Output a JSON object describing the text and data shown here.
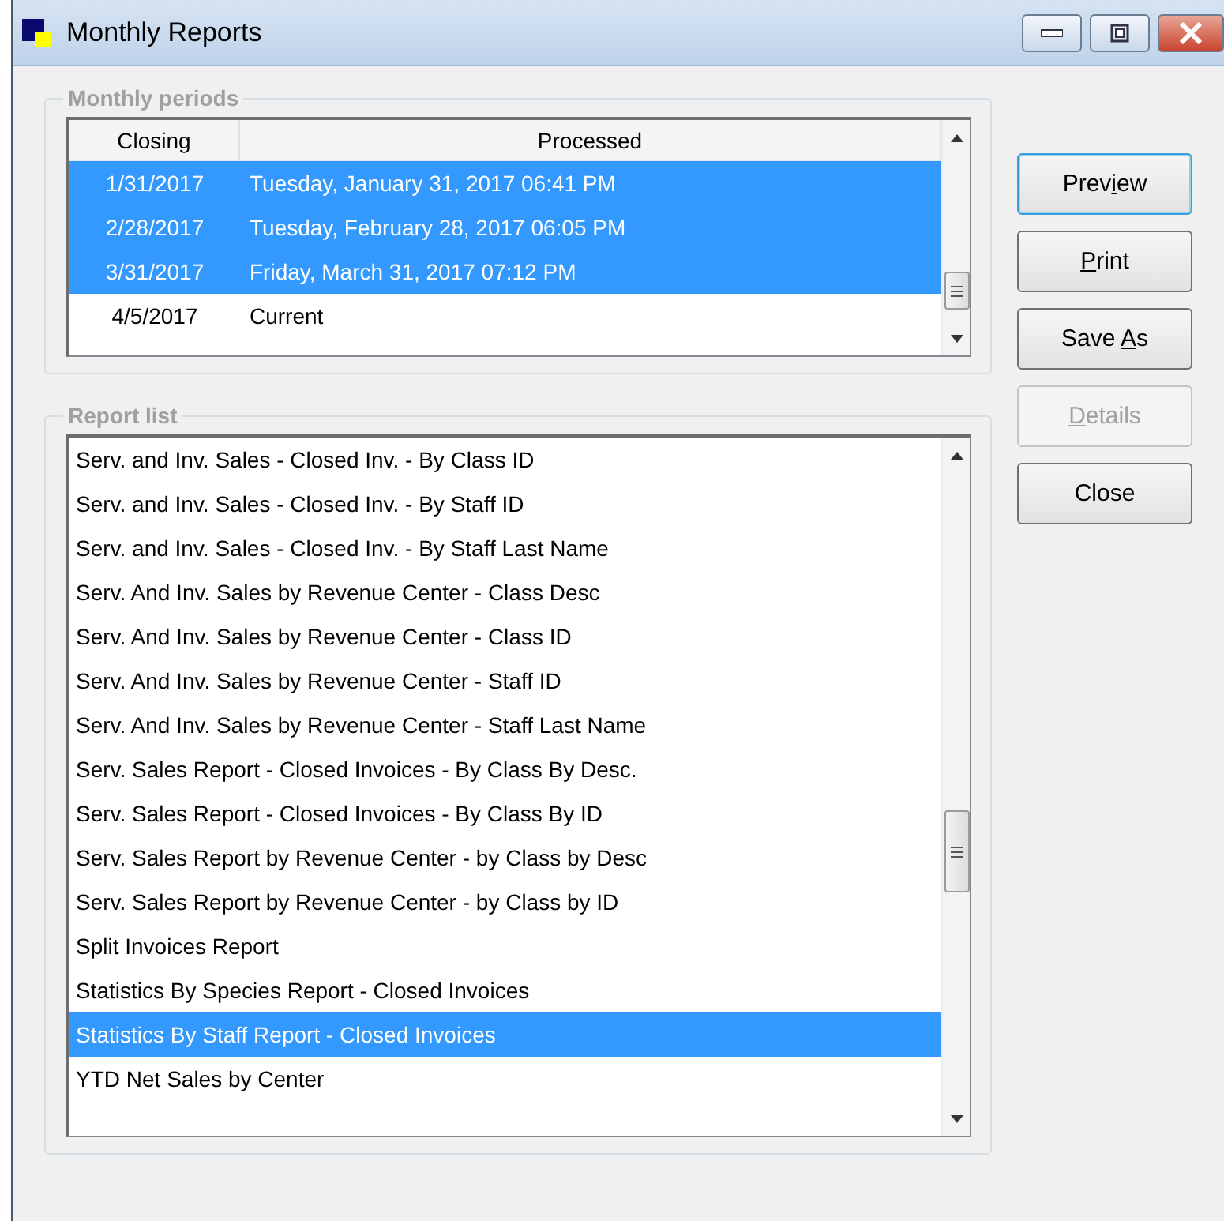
{
  "window": {
    "title": "Monthly Reports"
  },
  "monthly_periods": {
    "title": "Monthly periods",
    "columns": [
      "Closing",
      "Processed"
    ],
    "rows": [
      {
        "closing": "1/31/2017",
        "processed": "Tuesday, January 31, 2017 06:41 PM",
        "selected": true
      },
      {
        "closing": "2/28/2017",
        "processed": "Tuesday, February 28, 2017 06:05 PM",
        "selected": true
      },
      {
        "closing": "3/31/2017",
        "processed": "Friday, March 31, 2017 07:12 PM",
        "selected": true
      },
      {
        "closing": "4/5/2017",
        "processed": "Current",
        "selected": false
      }
    ]
  },
  "report_list": {
    "title": "Report list",
    "items": [
      {
        "label": "Serv. and Inv. Sales - Closed Inv. - By Class ID",
        "selected": false
      },
      {
        "label": "Serv. and Inv. Sales - Closed Inv. - By Staff ID",
        "selected": false
      },
      {
        "label": "Serv. and Inv. Sales - Closed Inv. - By Staff Last Name",
        "selected": false
      },
      {
        "label": "Serv. And Inv. Sales by Revenue Center - Class Desc",
        "selected": false
      },
      {
        "label": "Serv. And Inv. Sales by Revenue Center - Class ID",
        "selected": false
      },
      {
        "label": "Serv. And Inv. Sales by Revenue Center - Staff ID",
        "selected": false
      },
      {
        "label": "Serv. And Inv. Sales by Revenue Center - Staff Last Name",
        "selected": false
      },
      {
        "label": "Serv. Sales Report - Closed Invoices - By Class By Desc.",
        "selected": false
      },
      {
        "label": "Serv. Sales Report - Closed Invoices - By Class By ID",
        "selected": false
      },
      {
        "label": "Serv. Sales Report by Revenue Center - by Class by Desc",
        "selected": false
      },
      {
        "label": "Serv. Sales Report by Revenue Center - by Class by ID",
        "selected": false
      },
      {
        "label": "Split Invoices Report",
        "selected": false
      },
      {
        "label": "Statistics By Species Report - Closed Invoices",
        "selected": false
      },
      {
        "label": "Statistics By Staff Report - Closed Invoices",
        "selected": true
      },
      {
        "label": "YTD Net Sales by Center",
        "selected": false
      }
    ]
  },
  "buttons": [
    {
      "label": [
        {
          "text": "Prev",
          "underlined": false
        },
        {
          "text": "i",
          "underlined": true
        },
        {
          "text": "ew",
          "underlined": false
        }
      ],
      "default": true,
      "disabled": false
    },
    {
      "label": [
        {
          "text": "P",
          "underlined": true
        },
        {
          "text": "rint",
          "underlined": false
        }
      ],
      "default": false,
      "disabled": false
    },
    {
      "label": [
        {
          "text": "Save ",
          "underlined": false
        },
        {
          "text": "A",
          "underlined": true
        },
        {
          "text": "s",
          "underlined": false
        }
      ],
      "default": false,
      "disabled": false
    },
    {
      "label": [
        {
          "text": "D",
          "underlined": true
        },
        {
          "text": "etails",
          "underlined": false
        }
      ],
      "default": false,
      "disabled": true
    },
    {
      "label": [
        {
          "text": "Close",
          "underlined": false
        }
      ],
      "default": false,
      "disabled": false
    }
  ]
}
